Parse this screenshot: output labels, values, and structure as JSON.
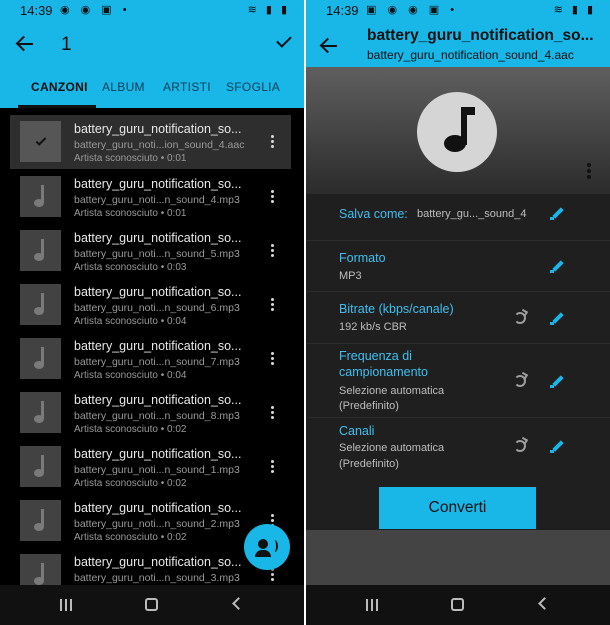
{
  "left": {
    "status": {
      "time": "14:39"
    },
    "selected_count": "1",
    "tabs": [
      {
        "label": "CANZONI"
      },
      {
        "label": "ALBUM"
      },
      {
        "label": "ARTISTI"
      },
      {
        "label": "SFOGLIA"
      }
    ],
    "songs": [
      {
        "title": "battery_guru_notification_so...",
        "file": "battery_guru_noti...ion_sound_4.aac",
        "meta": "Artista sconosciuto • 0:01",
        "selected": true
      },
      {
        "title": "battery_guru_notification_so...",
        "file": "battery_guru_noti...n_sound_4.mp3",
        "meta": "Artista sconosciuto • 0:01"
      },
      {
        "title": "battery_guru_notification_so...",
        "file": "battery_guru_noti...n_sound_5.mp3",
        "meta": "Artista sconosciuto • 0:03"
      },
      {
        "title": "battery_guru_notification_so...",
        "file": "battery_guru_noti...n_sound_6.mp3",
        "meta": "Artista sconosciuto • 0:04"
      },
      {
        "title": "battery_guru_notification_so...",
        "file": "battery_guru_noti...n_sound_7.mp3",
        "meta": "Artista sconosciuto • 0:04"
      },
      {
        "title": "battery_guru_notification_so...",
        "file": "battery_guru_noti...n_sound_8.mp3",
        "meta": "Artista sconosciuto • 0:02"
      },
      {
        "title": "battery_guru_notification_so...",
        "file": "battery_guru_noti...n_sound_1.mp3",
        "meta": "Artista sconosciuto • 0:02"
      },
      {
        "title": "battery_guru_notification_so...",
        "file": "battery_guru_noti...n_sound_2.mp3",
        "meta": "Artista sconosciuto • 0:02"
      },
      {
        "title": "battery_guru_notification_so...",
        "file": "battery_guru_noti...n_sound_3.mp3",
        "meta": ""
      }
    ]
  },
  "right": {
    "status": {
      "time": "14:39"
    },
    "title": "battery_guru_notification_so...",
    "subtitle": "battery_guru_notification_sound_4.aac",
    "save_as": {
      "label": "Salva come:",
      "value": "battery_gu..._sound_4"
    },
    "format": {
      "label": "Formato",
      "value": "MP3"
    },
    "bitrate": {
      "label": "Bitrate (kbps/canale)",
      "value": "192 kb/s CBR"
    },
    "sample_rate": {
      "label_1": "Frequenza di",
      "label_2": "campionamento",
      "value_1": "Selezione automatica",
      "value_2": "(Predefinito)"
    },
    "channels": {
      "label": "Canali",
      "value_1": "Selezione automatica",
      "value_2": "(Predefinito)"
    },
    "convert_label": "Converti"
  },
  "colors": {
    "accent": "#19b6e8",
    "label_blue": "#3cc0ef",
    "list_bg": "#000000",
    "settings_bg": "#1f1f1f"
  }
}
